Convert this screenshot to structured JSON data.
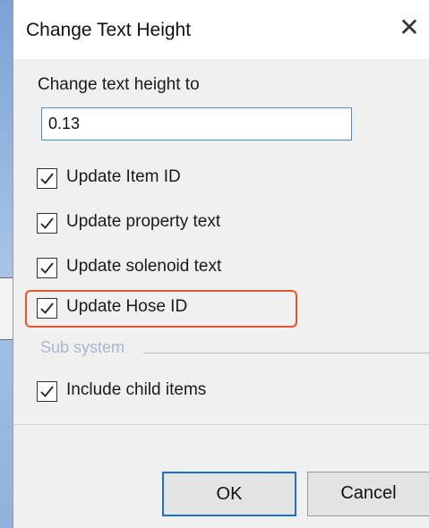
{
  "dialog": {
    "title": "Change Text Height",
    "close_glyph": "✕",
    "height_label": "Change text height to",
    "height_value": "0.13",
    "checkboxes": [
      {
        "label": "Update Item ID",
        "checked": true
      },
      {
        "label": "Update property text",
        "checked": true
      },
      {
        "label": "Update solenoid text",
        "checked": true
      },
      {
        "label": "Update Hose ID",
        "checked": true
      }
    ],
    "subsystem": {
      "label": "Sub system",
      "include_child": {
        "label": "Include child items",
        "checked": true
      }
    },
    "ok_label": "OK",
    "cancel_label": "Cancel"
  },
  "colors": {
    "highlight": "#e8542b",
    "input_border": "#4a8fd6",
    "default_button_border": "#1c6fd1"
  }
}
